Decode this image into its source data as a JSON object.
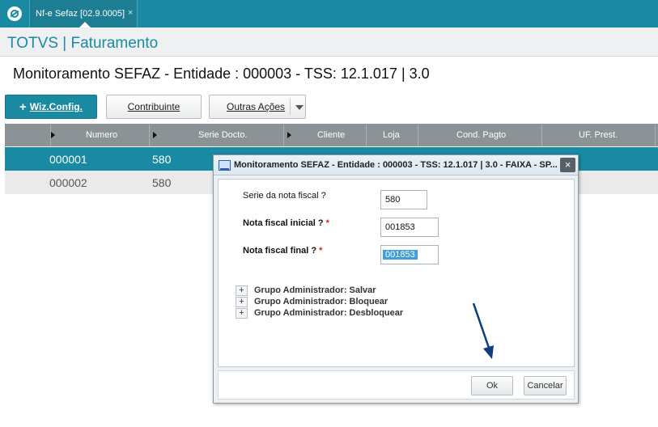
{
  "colors": {
    "accent": "#1a8aa3",
    "header_gray": "#8c9397",
    "required": "#d21f1f",
    "annotation_arrow": "#0d3d7a"
  },
  "topbar": {
    "logo_icon": "totvs-logo-icon",
    "tab_label": "Nf-e Sefaz [02.9.0005]",
    "tab_close": "×"
  },
  "module": {
    "title": "TOTVS | Faturamento"
  },
  "page": {
    "title": "Monitoramento SEFAZ - Entidade : 000003 - TSS: 12.1.017 | 3.0"
  },
  "toolbar": {
    "wiz_plus": "+",
    "wiz_label": "Wiz.Config.",
    "contribuinte_label": "Contribuinte",
    "outras_label": "Outras Ações"
  },
  "grid": {
    "columns": [
      "Numero",
      "Serie Docto.",
      "Cliente",
      "Loja",
      "Cond. Pagto",
      "UF. Prest."
    ],
    "rows": [
      {
        "numero": "000001",
        "serie": "580"
      },
      {
        "numero": "000002",
        "serie": "580"
      }
    ]
  },
  "dialog": {
    "title": "Monitoramento SEFAZ - Entidade : 000003 - TSS: 12.1.017 | 3.0 - FAIXA - SP...",
    "close": "×",
    "serie_label": "Serie da nota fiscal ?",
    "serie_value": "580",
    "inicial_label": "Nota fiscal inicial ?",
    "inicial_value": "001853",
    "final_label": "Nota fiscal final ?",
    "final_value": "001853",
    "required_mark": "*",
    "groups": [
      {
        "expand": "+",
        "label": "Grupo Administrador: Salvar"
      },
      {
        "expand": "+",
        "label": "Grupo Administrador: Bloquear"
      },
      {
        "expand": "+",
        "label": "Grupo Administrador: Desbloquear"
      }
    ],
    "ok_label": "Ok",
    "cancel_label": "Cancelar"
  }
}
